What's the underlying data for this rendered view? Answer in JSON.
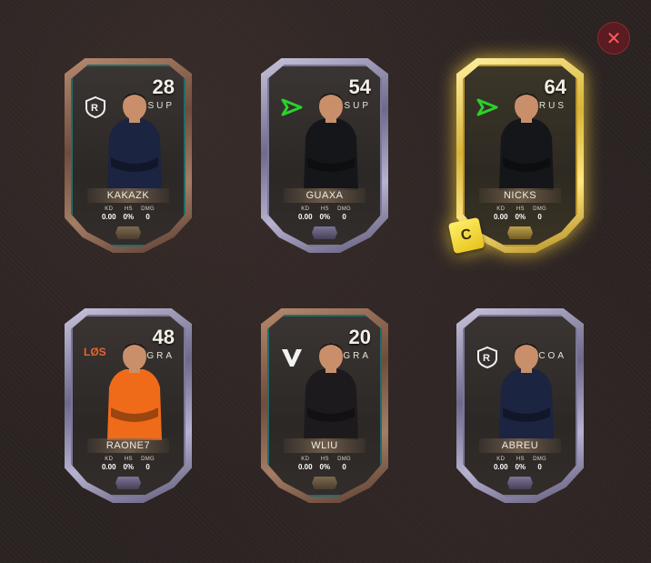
{
  "close": {
    "icon": "close-icon",
    "label": "✕"
  },
  "cards": [
    {
      "name": "KAKAZK",
      "rating": "28",
      "position": "SUP",
      "tier": "bronze",
      "logo": "r-team-logo-icon",
      "jersey": "#1b2440",
      "kd": "0.00",
      "hs": "0%",
      "dmg": "0"
    },
    {
      "name": "GUAXA",
      "rating": "54",
      "position": "SUP",
      "tier": "silver",
      "logo": "green-arrow-logo-icon",
      "jersey": "#15161a",
      "kd": "0.00",
      "hs": "0%",
      "dmg": "0"
    },
    {
      "name": "NICKS",
      "rating": "64",
      "position": "RUS",
      "tier": "gold",
      "logo": "green-arrow-logo-icon",
      "jersey": "#15161a",
      "kd": "0.00",
      "hs": "0%",
      "dmg": "0",
      "captain": "C"
    },
    {
      "name": "RAONE7",
      "rating": "48",
      "position": "GRA",
      "tier": "silver",
      "logo": "los-logo-icon",
      "jersey": "#ef6b1a",
      "kd": "0.00",
      "hs": "0%",
      "dmg": "0"
    },
    {
      "name": "WLIU",
      "rating": "20",
      "position": "GRA",
      "tier": "bronze",
      "logo": "w-team-logo-icon",
      "jersey": "#1c1a1d",
      "kd": "0.00",
      "hs": "0%",
      "dmg": "0"
    },
    {
      "name": "ABREU",
      "rating": "",
      "position": "COA",
      "tier": "silver",
      "logo": "r-team-logo-icon",
      "jersey": "#1b2440",
      "kd": "0.00",
      "hs": "0%",
      "dmg": "0"
    }
  ],
  "stat_labels": {
    "kd": "KD",
    "hs": "HS",
    "dmg": "DMG"
  },
  "colors": {
    "gold": "#ffd84a",
    "silver": "#b7b2cf",
    "bronze": "#a57d65",
    "accent_green": "#2bd12b",
    "close_red": "#ff5a5a"
  }
}
